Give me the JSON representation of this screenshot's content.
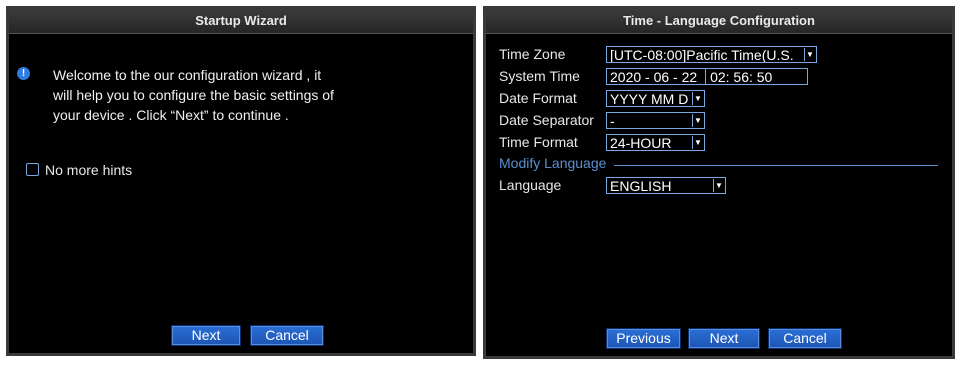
{
  "wizard": {
    "title": "Startup Wizard",
    "info_icon": "info-icon",
    "welcome_lines": [
      "Welcome to the our configuration wizard , it",
      "will help you to configure the basic settings of",
      "your device . Click “Next” to continue ."
    ],
    "no_more_hints": "No more hints",
    "next_label": "Next",
    "cancel_label": "Cancel"
  },
  "config": {
    "title": "Time - Language Configuration",
    "time_zone": {
      "label": "Time Zone",
      "value": "[UTC-08:00]Pacific Time(U.S."
    },
    "system_time": {
      "label": "System Time",
      "date": "2020 - 06 - 22",
      "time": "02: 56: 50"
    },
    "date_format": {
      "label": "Date Format",
      "value": "YYYY MM D"
    },
    "date_separator": {
      "label": "Date Separator",
      "value": "-"
    },
    "time_format": {
      "label": "Time Format",
      "value": "24-HOUR"
    },
    "modify_language": "Modify Language",
    "language": {
      "label": "Language",
      "value": "ENGLISH"
    },
    "previous_label": "Previous",
    "next_label": "Next",
    "cancel_label": "Cancel"
  }
}
